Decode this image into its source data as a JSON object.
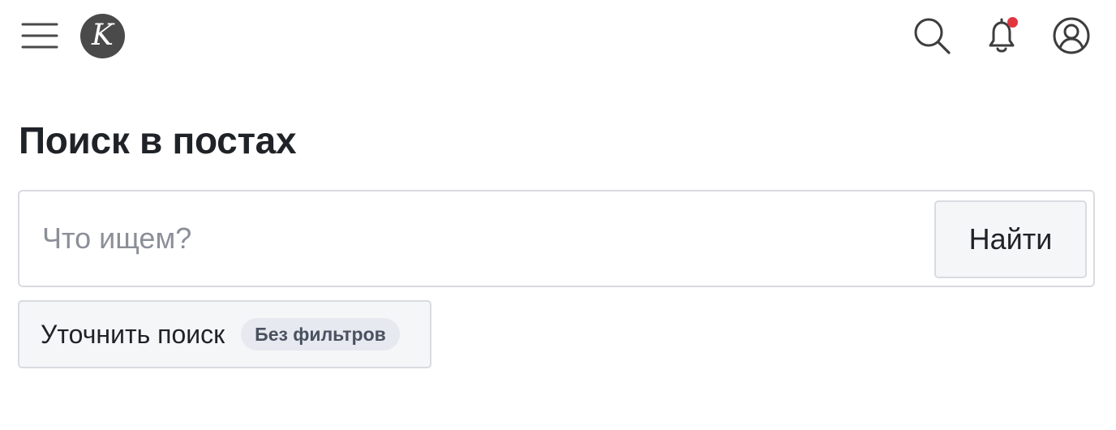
{
  "header": {
    "menu_icon": "hamburger-menu-icon",
    "logo_letter": "K",
    "search_icon": "search-icon",
    "bell_icon": "bell-icon",
    "user_icon": "user-avatar-icon",
    "notification_color": "#e0363f"
  },
  "page": {
    "title": "Поиск в постах"
  },
  "search": {
    "placeholder": "Что ищем?",
    "value": "",
    "submit_label": "Найти"
  },
  "refine": {
    "label": "Уточнить поиск",
    "badge": "Без фильтров"
  }
}
